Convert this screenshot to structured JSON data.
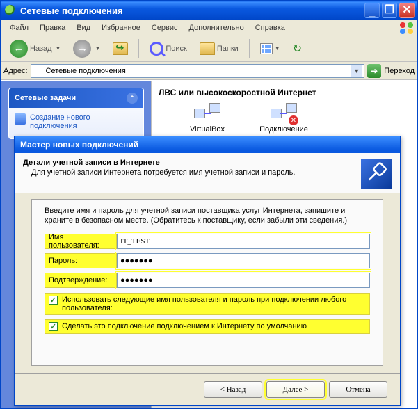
{
  "window": {
    "title": "Сетевые подключения"
  },
  "menu": {
    "file": "Файл",
    "edit": "Правка",
    "view": "Вид",
    "favorites": "Избранное",
    "tools": "Сервис",
    "advanced": "Дополнительно",
    "help": "Справка"
  },
  "toolbar": {
    "back": "Назад",
    "search": "Поиск",
    "folders": "Папки"
  },
  "address": {
    "label": "Адрес:",
    "value": "Сетевые подключения",
    "go": "Переход"
  },
  "tasks": {
    "header": "Сетевые задачи",
    "item1": "Создание нового подключения"
  },
  "lan": {
    "header": "ЛВС или высокоскоростной Интернет",
    "item1": "VirtualBox",
    "item2": "Подключение"
  },
  "wizard": {
    "title": "Мастер новых подключений",
    "heading": "Детали учетной записи в Интернете",
    "subheading": "Для учетной записи Интернета потребуется имя учетной записи и пароль.",
    "intro": "Введите имя и пароль для учетной записи поставщика услуг Интернета, запишите и храните в безопасном месте. (Обратитесь к поставщику, если забыли эти сведения.)",
    "label_user": "Имя пользователя:",
    "label_pass": "Пароль:",
    "label_confirm": "Подтверждение:",
    "value_user": "IT_TEST",
    "value_pass": "●●●●●●●",
    "value_confirm": "●●●●●●●",
    "chk1": "Использовать следующие имя пользователя и пароль при подключении любого пользователя:",
    "chk2": "Сделать это подключение подключением к Интернету по умолчанию",
    "btn_back": "< Назад",
    "btn_next": "Далее >",
    "btn_cancel": "Отмена"
  }
}
